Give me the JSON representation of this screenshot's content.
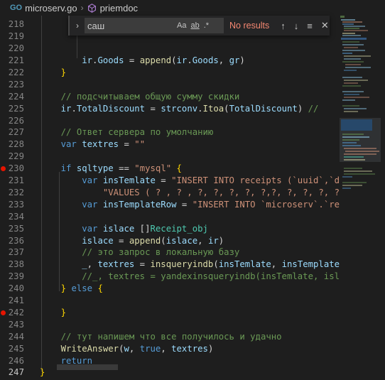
{
  "breadcrumb": {
    "file_badge": "GO",
    "file": "microserv.go",
    "symbol": "priemdoc"
  },
  "find": {
    "query": "саш",
    "opt_case": "Aa",
    "opt_word": "ab",
    "opt_regex": ".*",
    "status": "No results"
  },
  "lines": [
    {
      "n": "218",
      "tokens": []
    },
    {
      "n": "219",
      "tokens": []
    },
    {
      "n": "220",
      "tokens": []
    },
    {
      "n": "221",
      "tokens": [
        [
          "pl",
          "        "
        ],
        [
          "id",
          "ir"
        ],
        [
          "pl",
          "."
        ],
        [
          "id",
          "Goods"
        ],
        [
          "pl",
          " = "
        ],
        [
          "fn",
          "append"
        ],
        [
          "pl",
          "("
        ],
        [
          "id",
          "ir"
        ],
        [
          "pl",
          "."
        ],
        [
          "id",
          "Goods"
        ],
        [
          "pl",
          ", "
        ],
        [
          "id",
          "gr"
        ],
        [
          "pl",
          ")"
        ]
      ]
    },
    {
      "n": "222",
      "tokens": [
        [
          "pl",
          "    "
        ],
        [
          "br",
          "}"
        ]
      ]
    },
    {
      "n": "223",
      "tokens": []
    },
    {
      "n": "224",
      "tokens": [
        [
          "pl",
          "    "
        ],
        [
          "cm",
          "// подсчитываем общую сумму скидки"
        ]
      ]
    },
    {
      "n": "225",
      "tokens": [
        [
          "pl",
          "    "
        ],
        [
          "id",
          "ir"
        ],
        [
          "pl",
          "."
        ],
        [
          "id",
          "TotalDiscount"
        ],
        [
          "pl",
          " = "
        ],
        [
          "id",
          "strconv"
        ],
        [
          "pl",
          "."
        ],
        [
          "fn",
          "Itoa"
        ],
        [
          "pl",
          "("
        ],
        [
          "id",
          "TotalDiscount"
        ],
        [
          "pl",
          ") "
        ],
        [
          "cm",
          "//"
        ]
      ]
    },
    {
      "n": "226",
      "tokens": []
    },
    {
      "n": "227",
      "tokens": [
        [
          "pl",
          "    "
        ],
        [
          "cm",
          "// Ответ сервера по умолчанию"
        ]
      ]
    },
    {
      "n": "228",
      "tokens": [
        [
          "pl",
          "    "
        ],
        [
          "kw",
          "var"
        ],
        [
          "pl",
          " "
        ],
        [
          "id",
          "textres"
        ],
        [
          "pl",
          " = "
        ],
        [
          "str",
          "\"\""
        ]
      ]
    },
    {
      "n": "229",
      "tokens": []
    },
    {
      "n": "230",
      "bp": true,
      "tokens": [
        [
          "pl",
          "    "
        ],
        [
          "kw",
          "if"
        ],
        [
          "pl",
          " "
        ],
        [
          "id",
          "sqltype"
        ],
        [
          "pl",
          " == "
        ],
        [
          "str",
          "\"mysql\""
        ],
        [
          "pl",
          " "
        ],
        [
          "br",
          "{"
        ]
      ]
    },
    {
      "n": "231",
      "tokens": [
        [
          "pl",
          "        "
        ],
        [
          "kw",
          "var"
        ],
        [
          "pl",
          " "
        ],
        [
          "id",
          "insTemlate"
        ],
        [
          "pl",
          " = "
        ],
        [
          "str",
          "\"INSERT INTO receipts (`uuid`,`date`,"
        ]
      ]
    },
    {
      "n": "232",
      "tokens": [
        [
          "pl",
          "            "
        ],
        [
          "str",
          "\"VALUES ( ? , ? , ?, ?, ?, ?, ?,?, ?, ?, ?, ?"
        ]
      ]
    },
    {
      "n": "233",
      "tokens": [
        [
          "pl",
          "        "
        ],
        [
          "kw",
          "var"
        ],
        [
          "pl",
          " "
        ],
        [
          "id",
          "insTemplateRow"
        ],
        [
          "pl",
          " = "
        ],
        [
          "str",
          "\"INSERT INTO `microserv`.`receipt"
        ]
      ]
    },
    {
      "n": "234",
      "tokens": []
    },
    {
      "n": "235",
      "tokens": [
        [
          "pl",
          "        "
        ],
        [
          "kw",
          "var"
        ],
        [
          "pl",
          " "
        ],
        [
          "id",
          "islace"
        ],
        [
          "pl",
          " []"
        ],
        [
          "ty",
          "Receipt_obj"
        ]
      ]
    },
    {
      "n": "236",
      "tokens": [
        [
          "pl",
          "        "
        ],
        [
          "id",
          "islace"
        ],
        [
          "pl",
          " = "
        ],
        [
          "fn",
          "append"
        ],
        [
          "pl",
          "("
        ],
        [
          "id",
          "islace"
        ],
        [
          "pl",
          ", "
        ],
        [
          "id",
          "ir"
        ],
        [
          "pl",
          ")"
        ]
      ]
    },
    {
      "n": "237",
      "tokens": [
        [
          "pl",
          "        "
        ],
        [
          "cm",
          "// это запрос в локальную базу"
        ]
      ]
    },
    {
      "n": "238",
      "tokens": [
        [
          "pl",
          "        "
        ],
        [
          "id",
          "_"
        ],
        [
          "pl",
          ", "
        ],
        [
          "id",
          "textres"
        ],
        [
          "pl",
          " = "
        ],
        [
          "fn",
          "insqueryindb"
        ],
        [
          "pl",
          "("
        ],
        [
          "id",
          "insTemlate"
        ],
        [
          "pl",
          ", "
        ],
        [
          "id",
          "insTemplateRow"
        ],
        [
          "pl",
          ","
        ]
      ]
    },
    {
      "n": "239",
      "tokens": [
        [
          "pl",
          "        "
        ],
        [
          "cm",
          "//_, textres = yandexinsqueryindb(insTemlate, islace)"
        ]
      ]
    },
    {
      "n": "240",
      "tokens": [
        [
          "pl",
          "    "
        ],
        [
          "br",
          "}"
        ],
        [
          "pl",
          " "
        ],
        [
          "kw",
          "else"
        ],
        [
          "pl",
          " "
        ],
        [
          "br",
          "{"
        ]
      ]
    },
    {
      "n": "241",
      "tokens": []
    },
    {
      "n": "242",
      "bp": true,
      "tokens": [
        [
          "pl",
          "    "
        ],
        [
          "br",
          "}"
        ]
      ]
    },
    {
      "n": "243",
      "tokens": []
    },
    {
      "n": "244",
      "tokens": [
        [
          "pl",
          "    "
        ],
        [
          "cm",
          "// тут напишем что все получилось и удачно"
        ]
      ]
    },
    {
      "n": "245",
      "tokens": [
        [
          "pl",
          "    "
        ],
        [
          "fn",
          "WriteAnswer"
        ],
        [
          "pl",
          "("
        ],
        [
          "id",
          "w"
        ],
        [
          "pl",
          ", "
        ],
        [
          "kw",
          "true"
        ],
        [
          "pl",
          ", "
        ],
        [
          "id",
          "textres"
        ],
        [
          "pl",
          ")"
        ]
      ]
    },
    {
      "n": "246",
      "tokens": [
        [
          "pl",
          "    "
        ],
        [
          "kw",
          "return"
        ]
      ]
    },
    {
      "n": "247",
      "tokens": [
        [
          "br",
          "}"
        ]
      ]
    }
  ]
}
